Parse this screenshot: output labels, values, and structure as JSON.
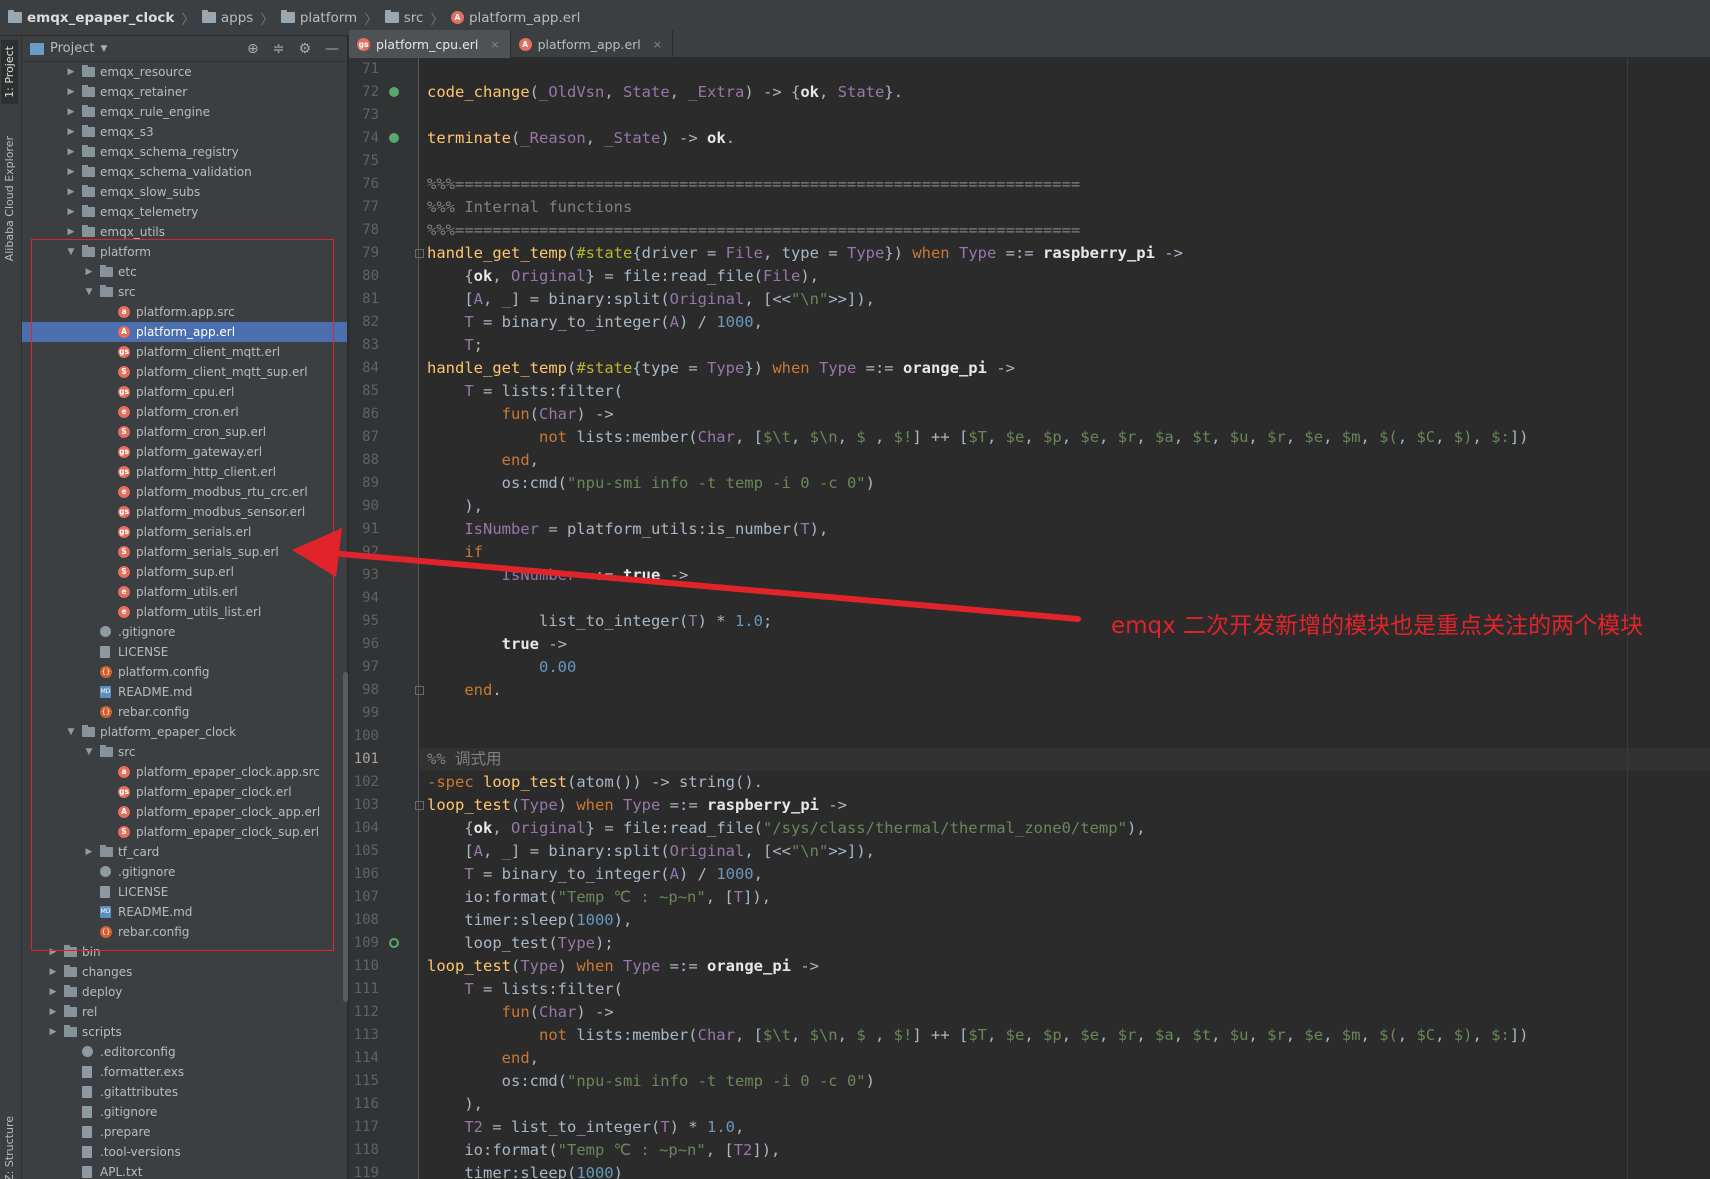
{
  "breadcrumb": {
    "items": [
      "emqx_epaper_clock",
      "apps",
      "platform",
      "src",
      "platform_app.erl"
    ]
  },
  "stripe": {
    "project_tab": "1: Project",
    "cloud_tab": "Alibaba Cloud Explorer",
    "structure_tab": "Z: Structure"
  },
  "project_panel": {
    "title": "Project",
    "tree": [
      {
        "label": "emqx_resource",
        "type": "folder",
        "depth": 2,
        "arrow": "right"
      },
      {
        "label": "emqx_retainer",
        "type": "folder",
        "depth": 2,
        "arrow": "right"
      },
      {
        "label": "emqx_rule_engine",
        "type": "folder",
        "depth": 2,
        "arrow": "right"
      },
      {
        "label": "emqx_s3",
        "type": "folder",
        "depth": 2,
        "arrow": "right"
      },
      {
        "label": "emqx_schema_registry",
        "type": "folder",
        "depth": 2,
        "arrow": "right"
      },
      {
        "label": "emqx_schema_validation",
        "type": "folder",
        "depth": 2,
        "arrow": "right"
      },
      {
        "label": "emqx_slow_subs",
        "type": "folder",
        "depth": 2,
        "arrow": "right"
      },
      {
        "label": "emqx_telemetry",
        "type": "folder",
        "depth": 2,
        "arrow": "right"
      },
      {
        "label": "emqx_utils",
        "type": "folder",
        "depth": 2,
        "arrow": "right"
      },
      {
        "label": "platform",
        "type": "folder",
        "depth": 2,
        "arrow": "down"
      },
      {
        "label": "etc",
        "type": "folder",
        "depth": 3,
        "arrow": "right"
      },
      {
        "label": "src",
        "type": "folder",
        "depth": 3,
        "arrow": "down"
      },
      {
        "label": "platform.app.src",
        "type": "erl",
        "glyph": "a",
        "depth": 4
      },
      {
        "label": "platform_app.erl",
        "type": "erl",
        "glyph": "A",
        "depth": 4,
        "selected": true
      },
      {
        "label": "platform_client_mqtt.erl",
        "type": "erl",
        "glyph": "gs",
        "depth": 4
      },
      {
        "label": "platform_client_mqtt_sup.erl",
        "type": "erl",
        "glyph": "S",
        "depth": 4
      },
      {
        "label": "platform_cpu.erl",
        "type": "erl",
        "glyph": "gs",
        "depth": 4
      },
      {
        "label": "platform_cron.erl",
        "type": "erl",
        "glyph": "e",
        "depth": 4
      },
      {
        "label": "platform_cron_sup.erl",
        "type": "erl",
        "glyph": "S",
        "depth": 4
      },
      {
        "label": "platform_gateway.erl",
        "type": "erl",
        "glyph": "gs",
        "depth": 4
      },
      {
        "label": "platform_http_client.erl",
        "type": "erl",
        "glyph": "gs",
        "depth": 4
      },
      {
        "label": "platform_modbus_rtu_crc.erl",
        "type": "erl",
        "glyph": "e",
        "depth": 4
      },
      {
        "label": "platform_modbus_sensor.erl",
        "type": "erl",
        "glyph": "gs",
        "depth": 4
      },
      {
        "label": "platform_serials.erl",
        "type": "erl",
        "glyph": "gs",
        "depth": 4
      },
      {
        "label": "platform_serials_sup.erl",
        "type": "erl",
        "glyph": "S",
        "depth": 4
      },
      {
        "label": "platform_sup.erl",
        "type": "erl",
        "glyph": "S",
        "depth": 4
      },
      {
        "label": "platform_utils.erl",
        "type": "erl",
        "glyph": "e",
        "depth": 4
      },
      {
        "label": "platform_utils_list.erl",
        "type": "erl",
        "glyph": "e",
        "depth": 4
      },
      {
        "label": ".gitignore",
        "type": "gear",
        "depth": 3
      },
      {
        "label": "LICENSE",
        "type": "txt",
        "depth": 3
      },
      {
        "label": "platform.config",
        "type": "cfg",
        "glyph": "{}",
        "depth": 3
      },
      {
        "label": "README.md",
        "type": "md",
        "glyph": "MD",
        "depth": 3
      },
      {
        "label": "rebar.config",
        "type": "cfg",
        "glyph": "{}",
        "depth": 3
      },
      {
        "label": "platform_epaper_clock",
        "type": "folder",
        "depth": 2,
        "arrow": "down"
      },
      {
        "label": "src",
        "type": "folder",
        "depth": 3,
        "arrow": "down"
      },
      {
        "label": "platform_epaper_clock.app.src",
        "type": "erl",
        "glyph": "a",
        "depth": 4
      },
      {
        "label": "platform_epaper_clock.erl",
        "type": "erl",
        "glyph": "gs",
        "depth": 4
      },
      {
        "label": "platform_epaper_clock_app.erl",
        "type": "erl",
        "glyph": "A",
        "depth": 4
      },
      {
        "label": "platform_epaper_clock_sup.erl",
        "type": "erl",
        "glyph": "S",
        "depth": 4
      },
      {
        "label": "tf_card",
        "type": "folder",
        "depth": 3,
        "arrow": "right"
      },
      {
        "label": ".gitignore",
        "type": "gear",
        "depth": 3
      },
      {
        "label": "LICENSE",
        "type": "txt",
        "depth": 3
      },
      {
        "label": "README.md",
        "type": "md",
        "glyph": "MD",
        "depth": 3
      },
      {
        "label": "rebar.config",
        "type": "cfg",
        "glyph": "{}",
        "depth": 3
      },
      {
        "label": "bin",
        "type": "folder",
        "depth": 1,
        "arrow": "right"
      },
      {
        "label": "changes",
        "type": "folder",
        "depth": 1,
        "arrow": "right"
      },
      {
        "label": "deploy",
        "type": "folder",
        "depth": 1,
        "arrow": "right"
      },
      {
        "label": "rel",
        "type": "folder",
        "depth": 1,
        "arrow": "right"
      },
      {
        "label": "scripts",
        "type": "folder",
        "depth": 1,
        "arrow": "right"
      },
      {
        "label": ".editorconfig",
        "type": "gear",
        "depth": 2
      },
      {
        "label": ".formatter.exs",
        "type": "txt",
        "depth": 2
      },
      {
        "label": ".gitattributes",
        "type": "txt",
        "depth": 2
      },
      {
        "label": ".gitignore",
        "type": "txt",
        "depth": 2
      },
      {
        "label": ".prepare",
        "type": "txt",
        "depth": 2
      },
      {
        "label": ".tool-versions",
        "type": "txt",
        "depth": 2
      },
      {
        "label": "APL.txt",
        "type": "txt",
        "depth": 2
      }
    ]
  },
  "tabs": [
    {
      "label": "platform_cpu.erl",
      "glyph": "gs",
      "active": true
    },
    {
      "label": "platform_app.erl",
      "glyph": "A",
      "active": false
    }
  ],
  "editor": {
    "current_line": "101",
    "lines": [
      {
        "n": "71",
        "html": ""
      },
      {
        "n": "72",
        "mark": "impl",
        "html": "<span class=\"fn\">code_change</span>(<span class=\"vr\">_OldVsn</span>, <span class=\"vr\">State</span>, <span class=\"vr\">_Extra</span>) -> {<span class=\"at\">ok</span>, <span class=\"vr\">State</span>}."
      },
      {
        "n": "73",
        "html": ""
      },
      {
        "n": "74",
        "mark": "impl",
        "html": "<span class=\"fn\">terminate</span>(<span class=\"vr\">_Reason</span>, <span class=\"vr\">_State</span>) -> <span class=\"at\">ok</span>."
      },
      {
        "n": "75",
        "html": ""
      },
      {
        "n": "76",
        "html": "<span class=\"cm\">%%%===================================================================</span>"
      },
      {
        "n": "77",
        "html": "<span class=\"cm\">%%% Internal functions</span>"
      },
      {
        "n": "78",
        "html": "<span class=\"cm\">%%%===================================================================</span>"
      },
      {
        "n": "79",
        "mark": "fold",
        "html": "<span class=\"fn\">handle_get_temp</span>(<span class=\"mac\">#state</span>{driver = <span class=\"vr\">File</span>, type = <span class=\"vr\">Type</span>}) <span class=\"kw\">when</span> <span class=\"vr\">Type</span> =:= <span class=\"at\">raspberry_pi</span> ->"
      },
      {
        "n": "80",
        "html": "    {<span class=\"at\">ok</span>, <span class=\"vr\">Original</span>} = file:read_file(<span class=\"vr\">File</span>),"
      },
      {
        "n": "81",
        "html": "    [<span class=\"vr\">A</span>, <span class=\"vr\">_</span>] = binary:split(<span class=\"vr\">Original</span>, [<<<span class=\"st\">\"\\n\"</span>>>]),"
      },
      {
        "n": "82",
        "html": "    <span class=\"vr\">T</span> = binary_to_integer(<span class=\"vr\">A</span>) / <span class=\"nu\">1000</span>,"
      },
      {
        "n": "83",
        "html": "    <span class=\"vr\">T</span>;"
      },
      {
        "n": "84",
        "html": "<span class=\"fn\">handle_get_temp</span>(<span class=\"mac\">#state</span>{type = <span class=\"vr\">Type</span>}) <span class=\"kw\">when</span> <span class=\"vr\">Type</span> =:= <span class=\"at\">orange_pi</span> ->"
      },
      {
        "n": "85",
        "html": "    <span class=\"vr\">T</span> = lists:filter("
      },
      {
        "n": "86",
        "html": "        <span class=\"kw\">fun</span>(<span class=\"vr\">Char</span>) ->"
      },
      {
        "n": "87",
        "html": "            <span class=\"kw\">not</span> lists:member(<span class=\"vr\">Char</span>, [<span class=\"st\">$\\t</span>, <span class=\"st\">$\\n</span>, <span class=\"st\">$ </span>, <span class=\"st\">$!</span>] ++ [<span class=\"st\">$T</span>, <span class=\"st\">$e</span>, <span class=\"st\">$p</span>, <span class=\"st\">$e</span>, <span class=\"st\">$r</span>, <span class=\"st\">$a</span>, <span class=\"st\">$t</span>, <span class=\"st\">$u</span>, <span class=\"st\">$r</span>, <span class=\"st\">$e</span>, <span class=\"st\">$m</span>, <span class=\"st\">$(</span>, <span class=\"st\">$C</span>, <span class=\"st\">$)</span>, <span class=\"st\">$:</span>])"
      },
      {
        "n": "88",
        "html": "        <span class=\"kw\">end</span>,"
      },
      {
        "n": "89",
        "html": "        os:cmd(<span class=\"st\">\"npu-smi info -t temp -i 0 -c 0\"</span>)"
      },
      {
        "n": "90",
        "html": "    ),"
      },
      {
        "n": "91",
        "html": "    <span class=\"vr\">IsNumber</span> = platform_utils:is_number(<span class=\"vr\">T</span>),"
      },
      {
        "n": "92",
        "html": "    <span class=\"kw\">if</span>"
      },
      {
        "n": "93",
        "html": "        <span class=\"vr\">IsNumber</span> =:= <span class=\"at\">true</span> ->"
      },
      {
        "n": "94",
        "html": ""
      },
      {
        "n": "95",
        "html": "            list_to_integer(<span class=\"vr\">T</span>) * <span class=\"nu\">1.0</span>;"
      },
      {
        "n": "96",
        "html": "        <span class=\"at\">true</span> ->"
      },
      {
        "n": "97",
        "html": "            <span class=\"nu\">0.00</span>"
      },
      {
        "n": "98",
        "mark": "fold",
        "html": "    <span class=\"kw\">end</span>."
      },
      {
        "n": "99",
        "html": ""
      },
      {
        "n": "100",
        "html": ""
      },
      {
        "n": "101",
        "html": "<span class=\"cm\">%% 调式用</span>"
      },
      {
        "n": "102",
        "html": "<span class=\"kw\">-spec</span> <span class=\"fn\">loop_test</span>(atom()) -> string()."
      },
      {
        "n": "103",
        "mark": "fold",
        "html": "<span class=\"fn\">loop_test</span>(<span class=\"vr\">Type</span>) <span class=\"kw\">when</span> <span class=\"vr\">Type</span> =:= <span class=\"at\">raspberry_pi</span> ->"
      },
      {
        "n": "104",
        "html": "    {<span class=\"at\">ok</span>, <span class=\"vr\">Original</span>} = file:read_file(<span class=\"st\">\"/sys/class/thermal/thermal_zone0/temp\"</span>),"
      },
      {
        "n": "105",
        "html": "    [<span class=\"vr\">A</span>, <span class=\"vr\">_</span>] = binary:split(<span class=\"vr\">Original</span>, [<<<span class=\"st\">\"\\n\"</span>>>]),"
      },
      {
        "n": "106",
        "html": "    <span class=\"vr\">T</span> = binary_to_integer(<span class=\"vr\">A</span>) / <span class=\"nu\">1000</span>,"
      },
      {
        "n": "107",
        "html": "    io:format(<span class=\"st\">\"Temp ℃ : ~p~n\"</span>, [<span class=\"vr\">T</span>]),"
      },
      {
        "n": "108",
        "html": "    timer:sleep(<span class=\"nu\">1000</span>),"
      },
      {
        "n": "109",
        "mark": "recur",
        "html": "    loop_test(<span class=\"vr\">Type</span>);"
      },
      {
        "n": "110",
        "html": "<span class=\"fn\">loop_test</span>(<span class=\"vr\">Type</span>) <span class=\"kw\">when</span> <span class=\"vr\">Type</span> =:= <span class=\"at\">orange_pi</span> ->"
      },
      {
        "n": "111",
        "html": "    <span class=\"vr\">T</span> = lists:filter("
      },
      {
        "n": "112",
        "html": "        <span class=\"kw\">fun</span>(<span class=\"vr\">Char</span>) ->"
      },
      {
        "n": "113",
        "html": "            <span class=\"kw\">not</span> lists:member(<span class=\"vr\">Char</span>, [<span class=\"st\">$\\t</span>, <span class=\"st\">$\\n</span>, <span class=\"st\">$ </span>, <span class=\"st\">$!</span>] ++ [<span class=\"st\">$T</span>, <span class=\"st\">$e</span>, <span class=\"st\">$p</span>, <span class=\"st\">$e</span>, <span class=\"st\">$r</span>, <span class=\"st\">$a</span>, <span class=\"st\">$t</span>, <span class=\"st\">$u</span>, <span class=\"st\">$r</span>, <span class=\"st\">$e</span>, <span class=\"st\">$m</span>, <span class=\"st\">$(</span>, <span class=\"st\">$C</span>, <span class=\"st\">$)</span>, <span class=\"st\">$:</span>])"
      },
      {
        "n": "114",
        "html": "        <span class=\"kw\">end</span>,"
      },
      {
        "n": "115",
        "html": "        os:cmd(<span class=\"st\">\"npu-smi info -t temp -i 0 -c 0\"</span>)"
      },
      {
        "n": "116",
        "html": "    ),"
      },
      {
        "n": "117",
        "html": "    <span class=\"vr\">T2</span> = list_to_integer(<span class=\"vr\">T</span>) * <span class=\"nu\">1.0</span>,"
      },
      {
        "n": "118",
        "html": "    io:format(<span class=\"st\">\"Temp ℃ : ~p~n\"</span>, [<span class=\"vr\">T2</span>]),"
      },
      {
        "n": "119",
        "html": "    timer:sleep(<span class=\"nu\">1000</span>)"
      }
    ]
  },
  "annotation": {
    "text": "emqx 二次开发新增的模块也是重点关注的两个模块",
    "color": "#e0242a"
  }
}
